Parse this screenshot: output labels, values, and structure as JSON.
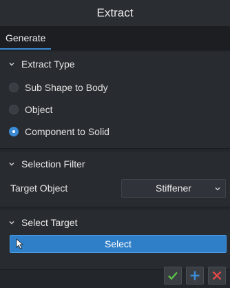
{
  "window": {
    "title": "Extract"
  },
  "tabs": [
    {
      "label": "Generate",
      "active": true
    }
  ],
  "extract_type": {
    "header": "Extract Type",
    "options": [
      {
        "label": "Sub Shape to Body",
        "checked": false
      },
      {
        "label": "Object",
        "checked": false
      },
      {
        "label": "Component to Solid",
        "checked": true
      }
    ]
  },
  "selection_filter": {
    "header": "Selection Filter",
    "target_object_label": "Target Object",
    "target_object_value": "Stiffener"
  },
  "select_target": {
    "header": "Select Target",
    "button_label": "Select"
  },
  "footer": {
    "icons": [
      "check-icon",
      "plus-icon",
      "close-icon"
    ],
    "colors": {
      "check": "#5cc24a",
      "plus": "#3b8bd5",
      "close": "#e04848"
    }
  },
  "colors": {
    "accent": "#3b8bd5",
    "background": "#23262b"
  }
}
